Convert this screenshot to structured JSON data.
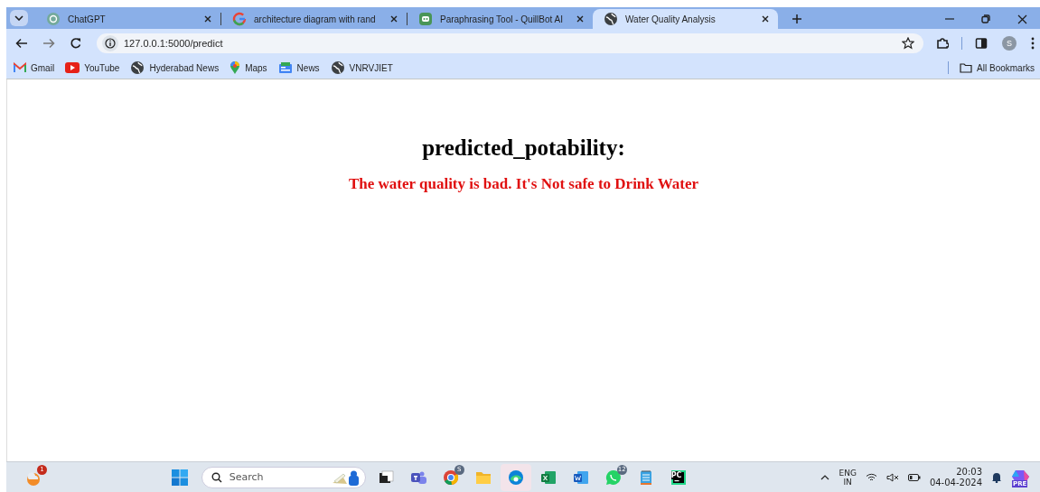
{
  "tabs": [
    {
      "kind": "chatgpt",
      "title": "ChatGPT",
      "selected": false
    },
    {
      "kind": "google",
      "title": "architecture diagram with rand",
      "selected": false
    },
    {
      "kind": "quillbot",
      "title": "Paraphrasing Tool - QuillBot AI",
      "selected": false
    },
    {
      "kind": "globe",
      "title": "Water Quality Analysis",
      "selected": true
    }
  ],
  "address": "127.0.0.1:5000/predict",
  "profile": "S",
  "bookmarks": [
    {
      "kind": "gmail",
      "label": "Gmail"
    },
    {
      "kind": "youtube",
      "label": "YouTube"
    },
    {
      "kind": "globe",
      "label": "Hyderabad News"
    },
    {
      "kind": "maps",
      "label": "Maps"
    },
    {
      "kind": "news",
      "label": "News"
    },
    {
      "kind": "globe",
      "label": "VNRVJIET"
    }
  ],
  "all_bookmarks": "All Bookmarks",
  "page": {
    "heading": "predicted_potability:",
    "message": "The water quality is bad. It's Not safe to Drink Water"
  },
  "taskbar": {
    "weather_badge": "1",
    "search_placeholder": "Search",
    "apps": [
      {
        "kind": "taskview",
        "selected": false
      },
      {
        "kind": "teams",
        "selected": false
      },
      {
        "kind": "chrome",
        "badge": "S",
        "selected": false
      },
      {
        "kind": "explorer",
        "selected": false
      },
      {
        "kind": "edge",
        "selected": true
      },
      {
        "kind": "excel",
        "selected": false
      },
      {
        "kind": "word",
        "selected": false
      },
      {
        "kind": "whatsapp",
        "badge": "12",
        "selected": false
      },
      {
        "kind": "notepad",
        "selected": false
      },
      {
        "kind": "pycharm",
        "label": "PC",
        "selected": false
      }
    ],
    "tray": {
      "language": "ENG",
      "region": "IN",
      "time": "20:03",
      "date": "04-04-2024",
      "copilot_label": "PRE"
    }
  }
}
